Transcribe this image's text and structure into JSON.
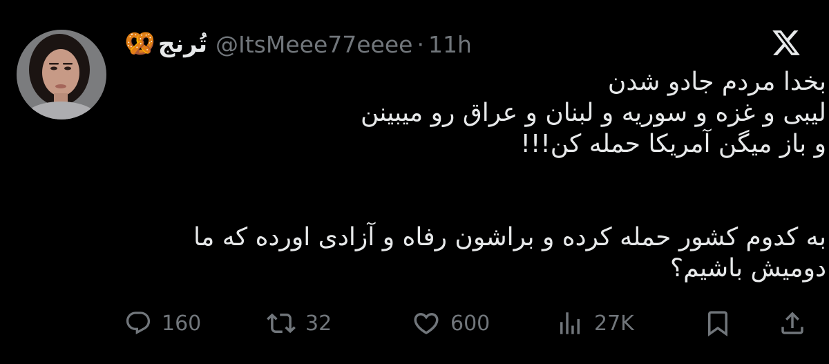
{
  "tweet": {
    "display_name": "تُرنج",
    "name_emoji": "🥨",
    "handle": "@ItsMeee77eeee",
    "separator": "·",
    "time": "11h",
    "body_lines_para1": [
      "بخدا مردم جادو شدن",
      "لیبی و غزه و سوریه و لبنان و عراق رو میبینن",
      "و باز میگن آمریکا حمله کن!!!"
    ],
    "body_lines_para2": [
      "به کدوم کشور حمله کرده و براشون رفاه و آزادی اورده که ما",
      "دومیش باشیم؟"
    ]
  },
  "actions": {
    "replies": "160",
    "reposts": "32",
    "likes": "600",
    "views": "27K"
  },
  "icons": {
    "reply": "reply-icon",
    "repost": "repost-icon",
    "like": "heart-icon",
    "views": "views-icon",
    "bookmark": "bookmark-icon",
    "share": "share-icon",
    "brand": "x-logo-icon"
  },
  "colors": {
    "background": "#000000",
    "text": "#e7e9ea",
    "muted": "#71767b"
  }
}
